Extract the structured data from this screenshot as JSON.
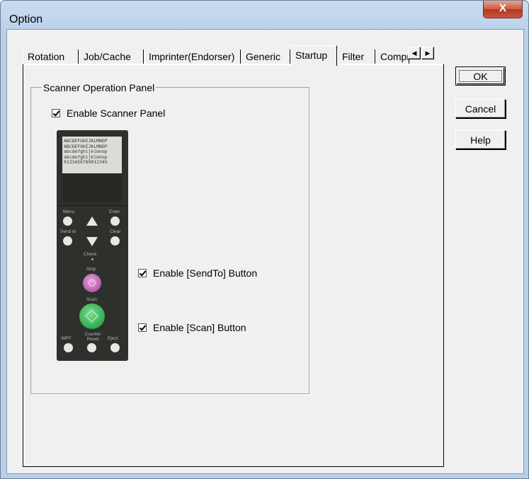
{
  "window": {
    "title": "Option",
    "close_glyph": "X"
  },
  "tabs": [
    {
      "label": "Rotation",
      "active": false
    },
    {
      "label": "Job/Cache",
      "active": false
    },
    {
      "label": "Imprinter(Endorser)",
      "active": false
    },
    {
      "label": "Generic",
      "active": false
    },
    {
      "label": "Startup",
      "active": true
    },
    {
      "label": "Filter",
      "active": false
    },
    {
      "label": "Compr",
      "active": false
    }
  ],
  "tab_scroll": {
    "left_glyph": "◀",
    "right_glyph": "▶"
  },
  "group": {
    "caption": "Scanner Operation Panel",
    "enable_panel": {
      "label": "Enable Scanner Panel",
      "checked": true
    },
    "enable_sendto": {
      "label": "Enable [SendTo] Button",
      "checked": true
    },
    "enable_scan": {
      "label": "Enable [Scan] Button",
      "checked": true
    }
  },
  "panel_image": {
    "lcd_lines": [
      "ABCDEFGHIJKLMNOP",
      "ABCDEFGHIJKLMNOP",
      "abcdefghijklmnop",
      "abcdefghijklmnop",
      "0123456789012345"
    ],
    "labels": {
      "menu": "Menu",
      "enter": "Enter",
      "send_to": "Send to",
      "clear": "Clear",
      "check": "Check",
      "stop": "Stop",
      "scan": "Scan",
      "imff": "iMFF",
      "counter_reset": "Counter Reset",
      "eject": "Eject"
    }
  },
  "buttons": {
    "ok": "OK",
    "cancel": "Cancel",
    "help": "Help"
  },
  "colors": {
    "stop_button": "#b65aaa",
    "scan_button": "#2eab4c",
    "close_button": "#c75b45"
  }
}
